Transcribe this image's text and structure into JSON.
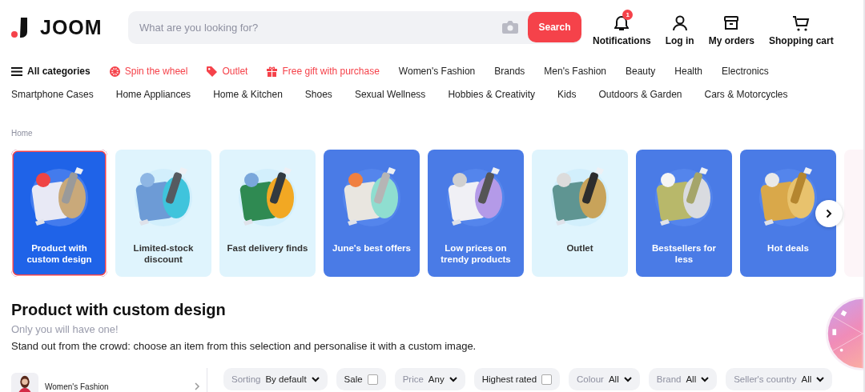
{
  "header": {
    "logo": "JOOM",
    "search": {
      "placeholder": "What are you looking for?",
      "button": "Search"
    },
    "actions": [
      {
        "kind": "bell",
        "label": "Notifications",
        "badge": "1"
      },
      {
        "kind": "user",
        "label": "Log in"
      },
      {
        "kind": "box",
        "label": "My orders"
      },
      {
        "kind": "cart",
        "label": "Shopping cart"
      }
    ]
  },
  "nav": [
    {
      "kind": "all",
      "label": "All categories"
    },
    {
      "kind": "wheel",
      "label": "Spin the wheel"
    },
    {
      "kind": "tag",
      "label": "Outlet"
    },
    {
      "kind": "gift",
      "label": "Free gift with purchase"
    },
    {
      "kind": "plain",
      "label": "Women's Fashion"
    },
    {
      "kind": "plain",
      "label": "Brands"
    },
    {
      "kind": "plain",
      "label": "Men's Fashion"
    },
    {
      "kind": "plain",
      "label": "Beauty"
    },
    {
      "kind": "plain",
      "label": "Health"
    },
    {
      "kind": "plain",
      "label": "Electronics"
    }
  ],
  "nav_2": [
    "Smartphone Cases",
    "Home Appliances",
    "Home & Kitchen",
    "Shoes",
    "Sexual Wellness",
    "Hobbies & Creativity",
    "Kids",
    "Outdoors & Garden",
    "Cars & Motorcycles"
  ],
  "breadcrumb": "Home",
  "tiles": [
    {
      "label": "Product with custom design",
      "kind": "dark",
      "selected": true
    },
    {
      "label": "Limited-stock discount",
      "kind": "light",
      "selected": false
    },
    {
      "label": "Fast delivery finds",
      "kind": "light",
      "selected": false
    },
    {
      "label": "June's best offers",
      "kind": "blue",
      "selected": false
    },
    {
      "label": "Low prices on trendy products",
      "kind": "blue",
      "selected": false
    },
    {
      "label": "Outlet",
      "kind": "light",
      "selected": false
    },
    {
      "label": "Bestsellers for less",
      "kind": "blue",
      "selected": false
    },
    {
      "label": "Hot deals",
      "kind": "blue",
      "selected": false
    }
  ],
  "section": {
    "title": "Product with custom design",
    "subtitle": "Only you will have one!",
    "description": "Stand out from the crowd: choose an item from this selection and personalise it with a custom image."
  },
  "sidebar": {
    "item": "Women's Fashion"
  },
  "filters": [
    {
      "kind": "dropdown",
      "label": "Sorting",
      "value": "By default"
    },
    {
      "kind": "checkbox",
      "label": "Sale",
      "checked": false
    },
    {
      "kind": "dropdown",
      "label": "Price",
      "value": "Any"
    },
    {
      "kind": "checkbox",
      "label": "Highest rated",
      "checked": false
    },
    {
      "kind": "dropdown",
      "label": "Colour",
      "value": "All"
    },
    {
      "kind": "dropdown",
      "label": "Brand",
      "value": "All"
    },
    {
      "kind": "dropdown",
      "label": "Seller's country",
      "value": "All"
    }
  ]
}
